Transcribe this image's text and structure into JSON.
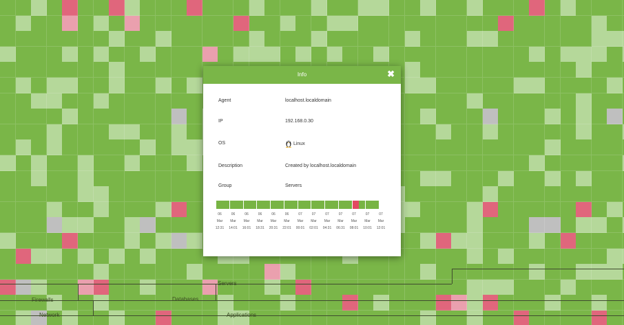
{
  "colors": {
    "ok": "#7ab648",
    "ok_light": "#b5d89a",
    "critical": "#e0667c",
    "warning": "#eaa0ae",
    "unknown": "#bfbfbf",
    "header": "#7ab648",
    "timeline_ok": "#78b444",
    "timeline_alert": "#e34a61"
  },
  "heatmap": {
    "groups": [
      {
        "label": "Servers"
      },
      {
        "label": "Firewalls"
      },
      {
        "label": "Databases"
      },
      {
        "label": "Network"
      },
      {
        "label": "Applications"
      }
    ]
  },
  "modal": {
    "title": "Info",
    "close_icon": "close-icon",
    "rows": [
      {
        "label": "Agent",
        "value": "localhost.localdomain"
      },
      {
        "label": "IP",
        "value": "192.168.0.30"
      },
      {
        "label": "OS",
        "value": "Linux",
        "icon": "linux-tux-icon"
      },
      {
        "label": "Description",
        "value": "Created by localhost.localdomain"
      },
      {
        "label": "Group",
        "value": "Servers"
      }
    ],
    "timeline": {
      "alert_start_fraction": 0.835,
      "alert_end_fraction": 0.875,
      "labels": [
        {
          "day": "06",
          "month": "Mar",
          "time": "12:31"
        },
        {
          "day": "06",
          "month": "Mar",
          "time": "14:01"
        },
        {
          "day": "06",
          "month": "Mar",
          "time": "16:01"
        },
        {
          "day": "06",
          "month": "Mar",
          "time": "18:31"
        },
        {
          "day": "06",
          "month": "Mar",
          "time": "20:31"
        },
        {
          "day": "06",
          "month": "Mar",
          "time": "22:01"
        },
        {
          "day": "07",
          "month": "Mar",
          "time": "00:01"
        },
        {
          "day": "07",
          "month": "Mar",
          "time": "02:01"
        },
        {
          "day": "07",
          "month": "Mar",
          "time": "04:31"
        },
        {
          "day": "07",
          "month": "Mar",
          "time": "06:31"
        },
        {
          "day": "07",
          "month": "Mar",
          "time": "08:01"
        },
        {
          "day": "07",
          "month": "Mar",
          "time": "10:01"
        },
        {
          "day": "07",
          "month": "Mar",
          "time": "12:01"
        }
      ]
    }
  }
}
